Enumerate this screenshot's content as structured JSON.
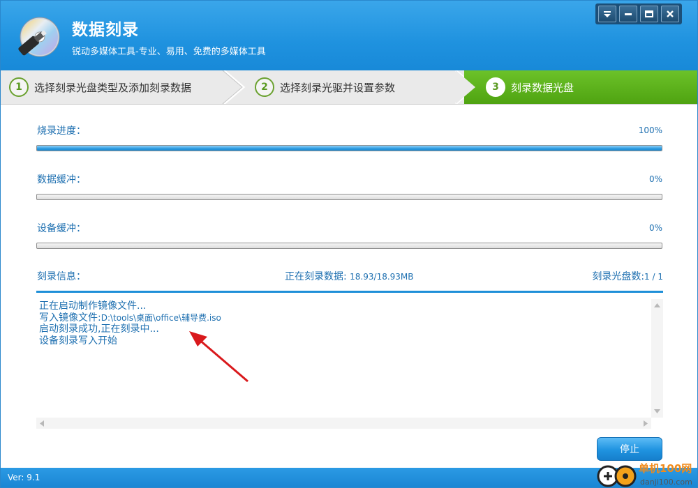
{
  "app": {
    "title": "数据刻录",
    "subtitle": "锐动多媒体工具-专业、易用、免费的多媒体工具",
    "logo_icon": "cd-disc-icon"
  },
  "window_controls": [
    "menu-icon",
    "minimize-icon",
    "maximize-icon",
    "close-icon"
  ],
  "steps": [
    {
      "num": "1",
      "label": "选择刻录光盘类型及添加刻录数据",
      "active": false
    },
    {
      "num": "2",
      "label": "选择刻录光驱并设置参数",
      "active": false
    },
    {
      "num": "3",
      "label": "刻录数据光盘",
      "active": true
    }
  ],
  "progress": {
    "burn": {
      "label": "烧录进度：",
      "percent_text": "100%",
      "value": 1.0
    },
    "data_buffer": {
      "label": "数据缓冲：",
      "percent_text": "0%",
      "value": 0.0
    },
    "device_buffer": {
      "label": "设备缓冲：",
      "percent_text": "0%",
      "value": 0.0
    }
  },
  "info": {
    "label": "刻录信息：",
    "writing_label": "正在刻录数据: ",
    "writing_value": "18.93/18.93MB",
    "disc_count_label": "刻录光盘数:",
    "disc_count_value": "1 / 1"
  },
  "log": [
    {
      "text": "正在启动制作镜像文件...",
      "mono": ""
    },
    {
      "text": "写入镜像文件:",
      "mono": "D:\\tools\\桌面\\office\\辅导费.iso"
    },
    {
      "text": "启动刻录成功,正在刻录中...",
      "mono": ""
    },
    {
      "text": "设备刻录写入开始",
      "mono": ""
    }
  ],
  "buttons": {
    "stop": "停止"
  },
  "status": {
    "version": "Ver: 9.1"
  },
  "watermark": {
    "brand": "单机100网",
    "url": "danji100.com"
  },
  "colors": {
    "accent": "#1f92df",
    "step_active": "#5ab01b",
    "text": "#1d6fb0"
  }
}
